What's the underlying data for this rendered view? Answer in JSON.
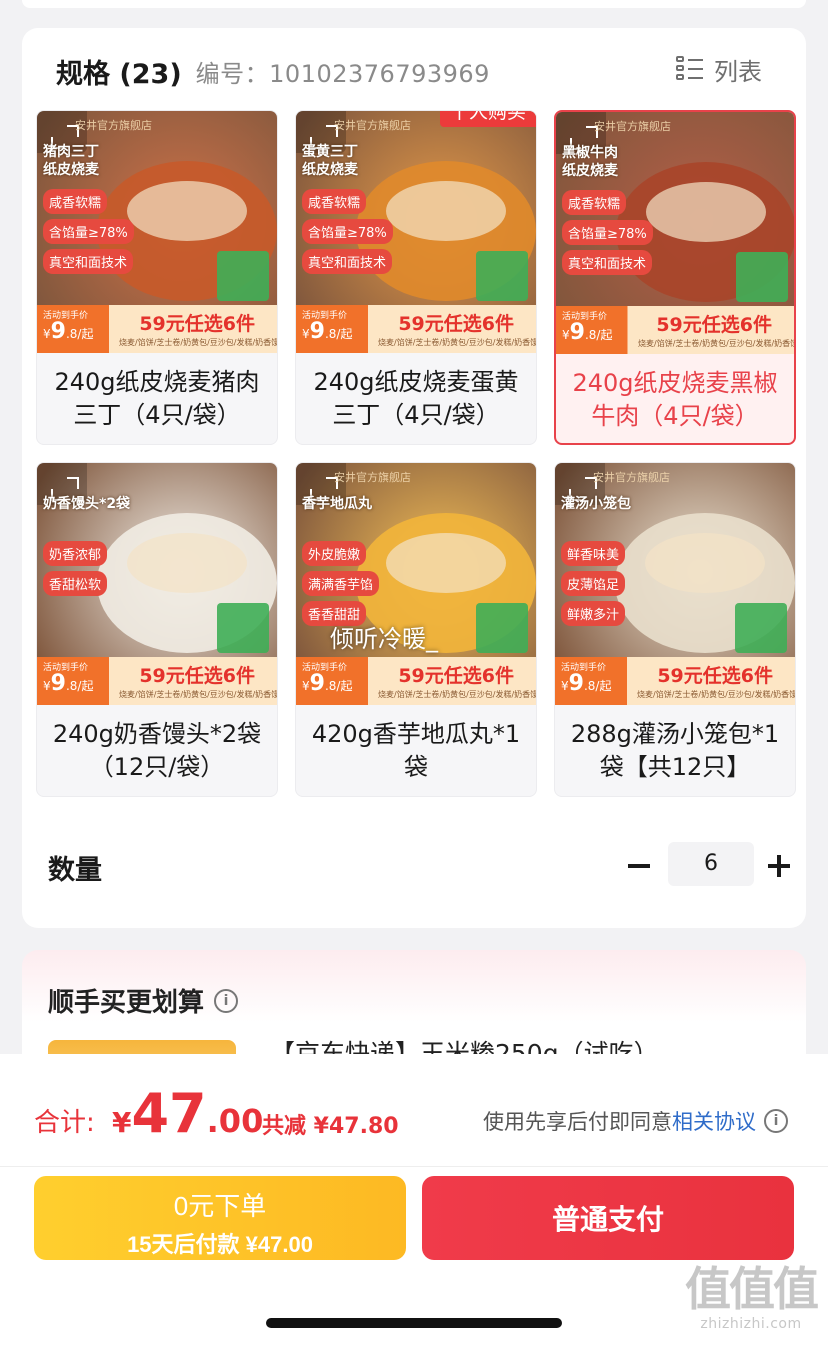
{
  "spec": {
    "title": "规格 (23)",
    "code_label": "编号：",
    "code_value": "10102376793969",
    "view_toggle": "列表"
  },
  "variants": [
    {
      "name": "240g纸皮烧麦猪肉三丁（4只/袋）",
      "selected": false,
      "badge": "",
      "thumb": {
        "label1": "猪肉三丁",
        "label2": "纸皮烧麦",
        "tags": [
          "咸香软糯",
          "含馅量≥78%",
          "真空和面技术"
        ],
        "shop": "安井官方旗舰店",
        "accent": "#c75a2a",
        "overlay_text": ""
      }
    },
    {
      "name": "240g纸皮烧麦蛋黄三丁（4只/袋）",
      "selected": false,
      "badge": "千人购买",
      "thumb": {
        "label1": "蛋黄三丁",
        "label2": "纸皮烧麦",
        "tags": [
          "咸香软糯",
          "含馅量≥78%",
          "真空和面技术"
        ],
        "shop": "安井官方旗舰店",
        "accent": "#e0892b",
        "overlay_text": ""
      }
    },
    {
      "name": "240g纸皮烧麦黑椒牛肉（4只/袋）",
      "selected": true,
      "badge": "",
      "thumb": {
        "label1": "黑椒牛肉",
        "label2": "纸皮烧麦",
        "tags": [
          "咸香软糯",
          "含馅量≥78%",
          "真空和面技术"
        ],
        "shop": "安井官方旗舰店",
        "accent": "#a8452a",
        "overlay_text": ""
      }
    },
    {
      "name": "240g奶香馒头*2袋（12只/袋）",
      "selected": false,
      "badge": "",
      "thumb": {
        "label1": "奶香馒头*2袋",
        "label2": "",
        "tags": [
          "奶香浓郁",
          "香甜松软"
        ],
        "shop": "",
        "accent": "#f1ece3",
        "overlay_text": ""
      }
    },
    {
      "name": "420g香芋地瓜丸*1袋",
      "selected": false,
      "badge": "",
      "thumb": {
        "label1": "香芋地瓜丸",
        "label2": "",
        "tags": [
          "外皮脆嫩",
          "满满香芋馅",
          "香香甜甜"
        ],
        "shop": "安井官方旗舰店",
        "accent": "#f2b53b",
        "overlay_text": "倾听冷暖_"
      }
    },
    {
      "name": "288g灌汤小笼包*1袋【共12只】",
      "selected": false,
      "badge": "",
      "thumb": {
        "label1": "灌汤小笼包",
        "label2": "",
        "tags": [
          "鲜香味美",
          "皮薄馅足",
          "鲜嫩多汁"
        ],
        "shop": "安井官方旗舰店",
        "accent": "#e9dfcc",
        "overlay_text": ""
      }
    }
  ],
  "price_strip": {
    "caption": "活动到手价",
    "currency": "¥",
    "price_int": "9",
    "price_dec": ".8/起",
    "deal": "59元任选6件",
    "categories": "烧麦/馅饼/芝士卷/奶黄包/豆沙包/发糕/奶香馒头"
  },
  "quantity": {
    "label": "数量",
    "value": "6"
  },
  "upsell": {
    "title": "顺手买更划算",
    "info_icon": "i",
    "item_name": "【京东快递】玉米糁250g（试吃）"
  },
  "total": {
    "label": "合计:",
    "currency": "¥",
    "amount_int": "47",
    "amount_dec": ".00",
    "save": "共减 ¥47.80",
    "agreement_prefix": "使用先享后付即同意",
    "agreement_link": "相关协议",
    "info_icon": "i"
  },
  "actions": {
    "pay_later_line1": "0元下单",
    "pay_later_line2": "15天后付款 ¥47.00",
    "pay_now": "普通支付"
  },
  "watermark": {
    "logo": "值值值",
    "url": "zhizhizhi.com"
  },
  "colors": {
    "accent_red": "#e8333a",
    "pay_later_yellow": "#fdb923",
    "link_blue": "#2f6cc9"
  }
}
